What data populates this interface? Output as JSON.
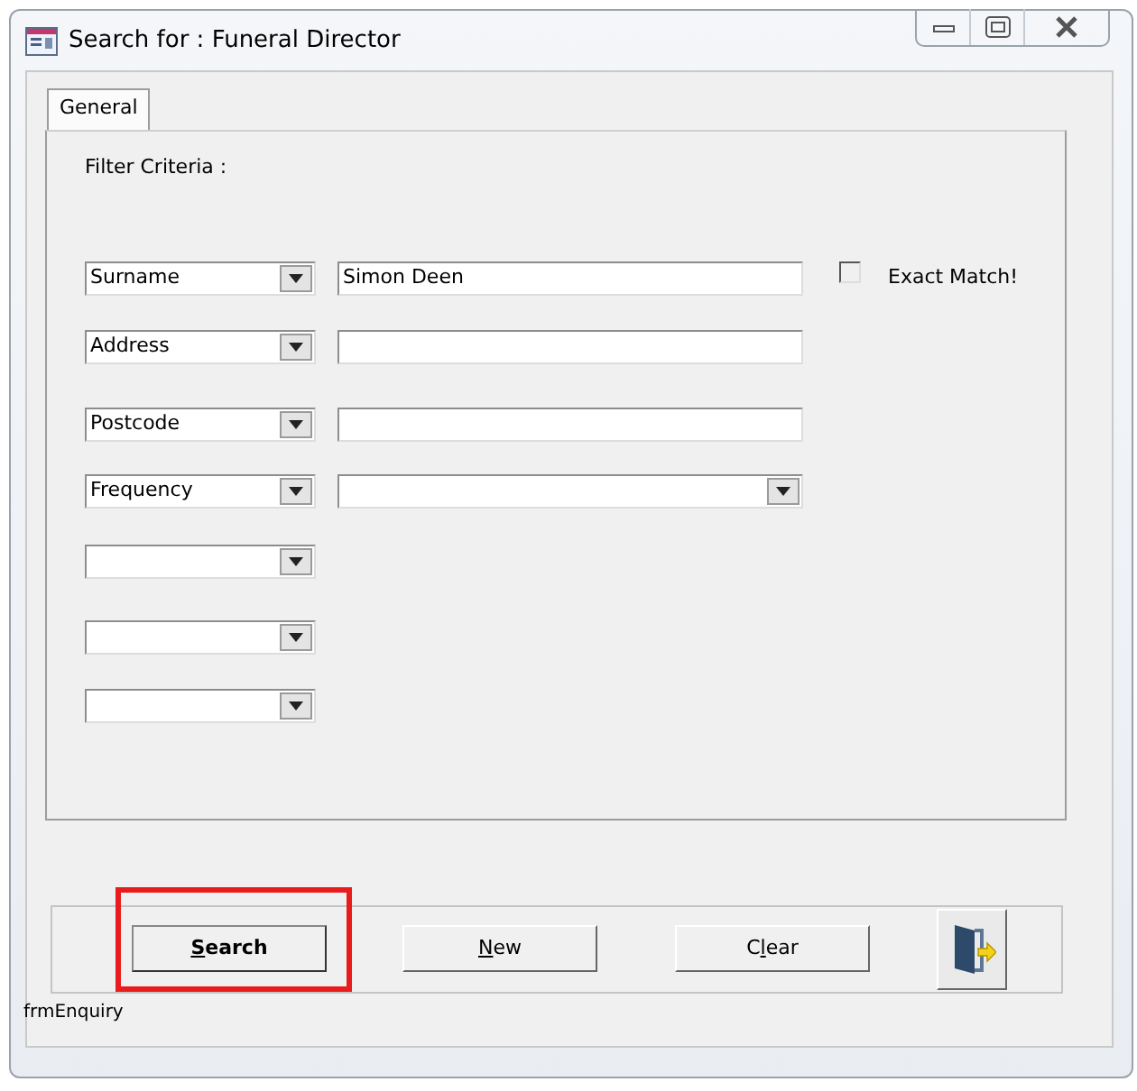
{
  "window": {
    "title": "Search for : Funeral Director"
  },
  "tabs": [
    {
      "label": "General",
      "selected": true
    }
  ],
  "filter_label": "Filter Criteria :",
  "criteria": [
    {
      "field": "Surname",
      "kind": "text",
      "value": "Simon Deen"
    },
    {
      "field": "Address",
      "kind": "text"
    },
    {
      "field": "Postcode",
      "kind": "text"
    },
    {
      "field": "Frequency",
      "kind": "combo"
    },
    {
      "kind": "none"
    },
    {
      "kind": "none"
    },
    {
      "kind": "none"
    }
  ],
  "exact_match": {
    "label": "Exact Match!",
    "checked": false
  },
  "buttons": [
    {
      "hotkey": "S",
      "label_end": "earch",
      "default": true,
      "highlighted": true
    },
    {
      "hotkey": "N",
      "label_end": "ew",
      "default": false,
      "highlighted": false
    },
    {
      "label_start": "C",
      "hotkey": "l",
      "label_end": "ear",
      "default": false,
      "highlighted": false
    }
  ],
  "form_name": "frmEnquiry"
}
